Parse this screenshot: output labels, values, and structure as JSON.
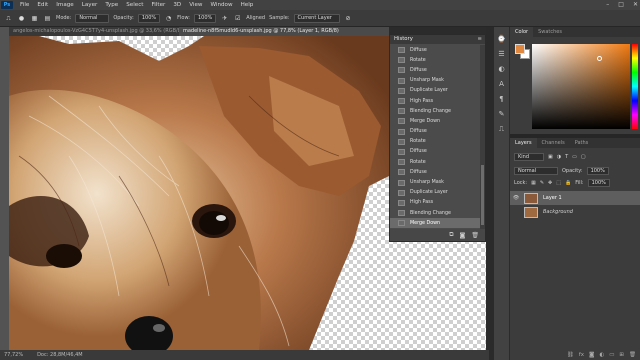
{
  "app": {
    "logo": "Ps"
  },
  "menu": [
    "File",
    "Edit",
    "Image",
    "Layer",
    "Type",
    "Select",
    "Filter",
    "3D",
    "View",
    "Window",
    "Help"
  ],
  "options": {
    "mode_label": "Mode:",
    "mode_value": "Normal",
    "opacity_label": "Opacity:",
    "opacity_value": "100%",
    "flow_label": "Flow:",
    "flow_value": "100%",
    "aligned_label": "Aligned",
    "sample_label": "Sample:",
    "sample_value": "Current Layer"
  },
  "tabs": [
    {
      "label": "angelos-michalopoulos-VzG4C5T7y4-unsplash.jpg @ 33,6% (RGB/8)"
    },
    {
      "label": "madeline-n8f5mudld6-unsplash.jpg @ 77,8% (Layer 1, RGB/8)"
    }
  ],
  "status": {
    "zoom": "77,72%",
    "doc": "Doc: 28,8M/46,4M"
  },
  "history": {
    "title": "History",
    "items": [
      "Diffuse",
      "Rotate",
      "Diffuse",
      "Unsharp Mask",
      "Duplicate Layer",
      "High Pass",
      "Blending Change",
      "Merge Down",
      "Diffuse",
      "Rotate",
      "Diffuse",
      "Rotate",
      "Diffuse",
      "Unsharp Mask",
      "Duplicate Layer",
      "High Pass",
      "Blending Change",
      "Merge Down"
    ],
    "selected_index": 17
  },
  "color_panel": {
    "tabs": [
      "Color",
      "Swatches"
    ],
    "foreground": "#e08840",
    "background": "#ffffff"
  },
  "layers_panel": {
    "tabs": [
      "Layers",
      "Channels",
      "Paths"
    ],
    "kind": "Kind",
    "blend": "Normal",
    "opacity_label": "Opacity:",
    "opacity": "100%",
    "lock_label": "Lock:",
    "fill_label": "Fill:",
    "fill": "100%",
    "layers": [
      {
        "name": "Layer 1",
        "selected": true
      },
      {
        "name": "Background",
        "selected": false
      }
    ]
  }
}
